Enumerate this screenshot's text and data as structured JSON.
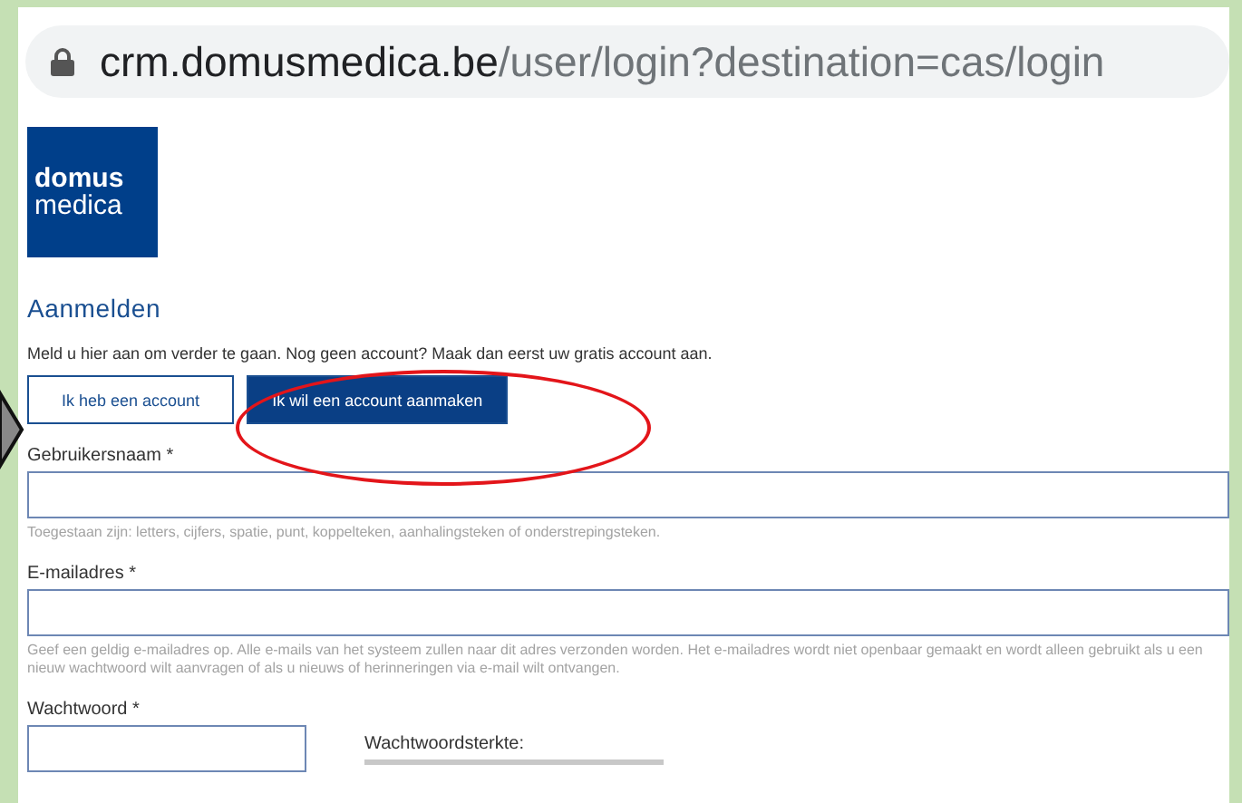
{
  "address_bar": {
    "domain": "crm.domusmedica.be",
    "path": "/user/login?destination=cas/login"
  },
  "logo": {
    "line_1": "domus",
    "line_2": "medica"
  },
  "heading": "Aanmelden",
  "intro": "Meld u hier aan om verder te gaan. Nog geen account? Maak dan eerst uw gratis account aan.",
  "buttons": [
    {
      "label": "Ik heb een account",
      "selected": false
    },
    {
      "label": "Ik wil een account aanmaken",
      "selected": true
    }
  ],
  "fields": [
    {
      "label": "Gebruikersnaam *",
      "kind": "wide",
      "hint": "Toegestaan zijn: letters, cijfers, spatie, punt, koppelteken, aanhalingsteken of onderstrepingsteken."
    },
    {
      "label": "E-mailadres *",
      "kind": "wide",
      "hint": "Geef een geldig e-mailadres op. Alle e-mails van het systeem zullen naar dit adres verzonden worden. Het e-mailadres wordt niet openbaar gemaakt en wordt alleen gebruikt als u een nieuw wachtwoord wilt aanvragen of als u nieuws of herinneringen via e-mail wilt ontvangen."
    },
    {
      "label": "Wachtwoord *",
      "kind": "password",
      "strength_label": "Wachtwoordsterkte:",
      "level": 0
    }
  ]
}
